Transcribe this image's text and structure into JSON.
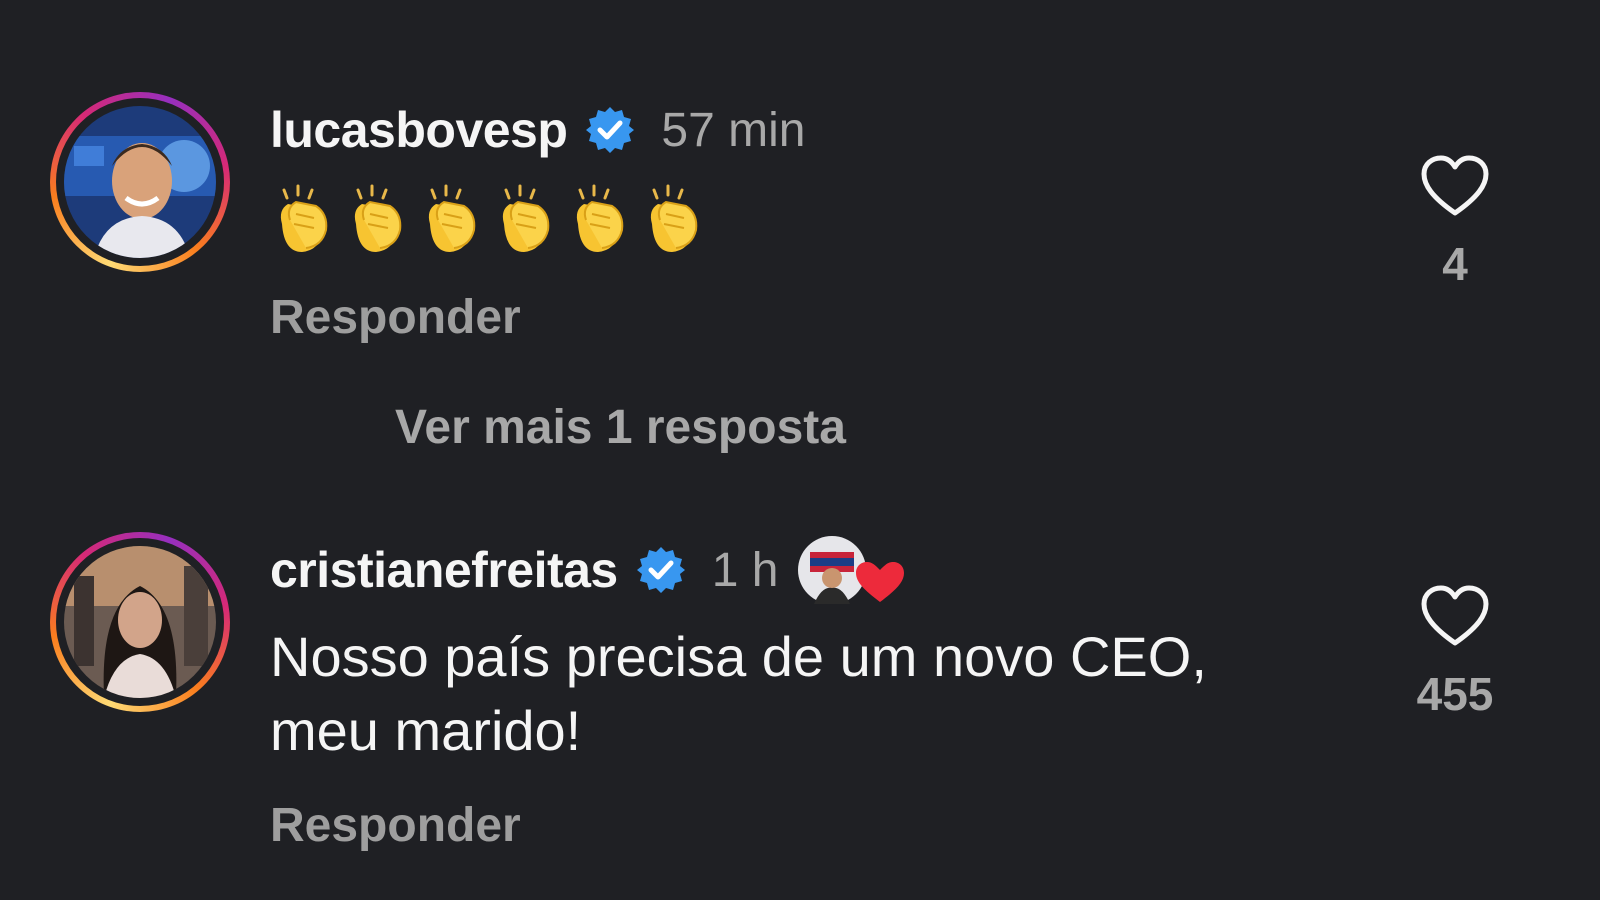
{
  "comments": [
    {
      "username": "lucasbovesp",
      "verified": true,
      "time": "57 min",
      "emoji": "clapping-hands",
      "emoji_count": 6,
      "reply_label": "Responder",
      "likes": "4"
    },
    {
      "username": "cristianefreitas",
      "verified": true,
      "time": "1 h",
      "text_line1": "Nosso país precisa de um novo CEO,",
      "text_line2": "meu marido!",
      "reply_label": "Responder",
      "likes": "455"
    }
  ],
  "more_replies": "Ver mais 1 resposta",
  "colors": {
    "background": "#1f2024",
    "verified_blue": "#3897f0",
    "heart_red": "#ed2a3b",
    "muted_text": "#a8a8a8"
  },
  "icons": [
    "verified-badge-icon",
    "heart-outline-icon",
    "clapping-hands-emoji",
    "creator-heart-reaction-icon"
  ]
}
